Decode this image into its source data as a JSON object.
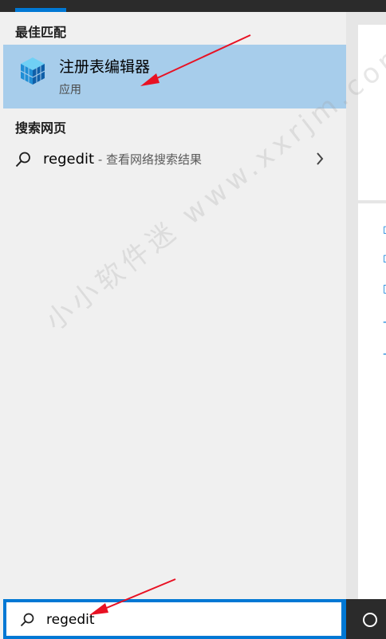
{
  "best_match": {
    "section_label": "最佳匹配",
    "app_name": "注册表编辑器",
    "app_type": "应用",
    "icon": "registry-editor-cube-icon"
  },
  "web_search": {
    "section_label": "搜索网页",
    "query": "regedit",
    "hint": " - 查看网络搜索结果",
    "icon": "search-icon",
    "chevron": "chevron-right-icon"
  },
  "search_box": {
    "value": "regedit",
    "icon": "search-icon"
  },
  "watermark": "小小软件迷 www.xxrjm.com",
  "taskbar": {
    "cortana_icon": "cortana-circle-icon"
  },
  "colors": {
    "accent": "#0078d4",
    "selected": "#a7cdeb",
    "arrow": "#e81123"
  }
}
